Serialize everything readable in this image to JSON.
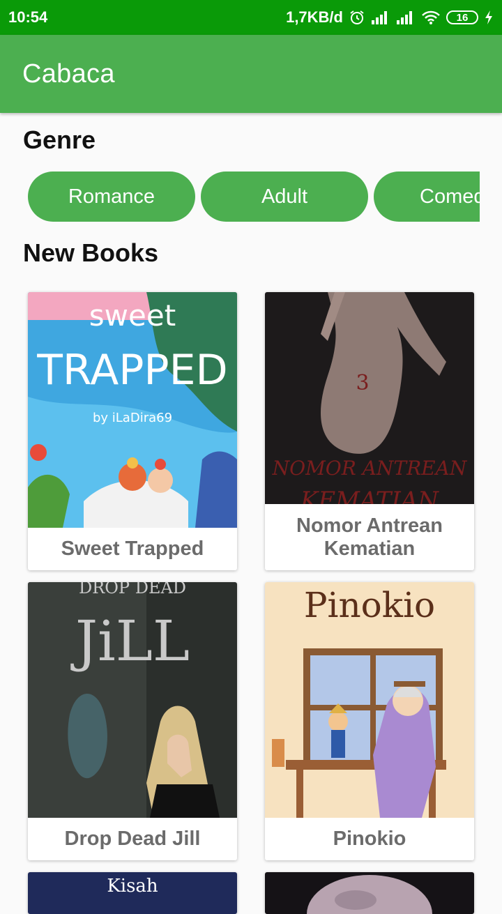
{
  "status_bar": {
    "time": "10:54",
    "network_speed": "1,7KB/d",
    "battery_level": "16"
  },
  "app_bar": {
    "title": "Cabaca"
  },
  "genre_section": {
    "heading": "Genre",
    "genres": [
      "Romance",
      "Adult",
      "Comedy"
    ]
  },
  "new_books_section": {
    "heading": "New Books",
    "books": [
      {
        "title": "Sweet Trapped",
        "cover_texts": [
          "sweet",
          "TRAPPED",
          "by iLaDira69"
        ]
      },
      {
        "title": "Nomor Antrean Kematian",
        "cover_texts": [
          "3",
          "NOMOR ANTREAN",
          "KEMATIAN"
        ]
      },
      {
        "title": "Drop Dead Jill",
        "cover_texts": [
          "DROP DEAD",
          "JiLL"
        ]
      },
      {
        "title": "Pinokio",
        "cover_texts": [
          "Pinokio"
        ]
      },
      {
        "title": "",
        "cover_texts": [
          "Kisah"
        ]
      },
      {
        "title": "",
        "cover_texts": []
      }
    ]
  },
  "colors": {
    "status_bar": "#0a9a08",
    "app_bar": "#4caf50",
    "accent": "#4caf50",
    "book_title": "#6b6b6b"
  },
  "icons": [
    "alarm-icon",
    "signal-icon",
    "signal-icon",
    "wifi-icon",
    "battery-icon",
    "charging-icon"
  ]
}
